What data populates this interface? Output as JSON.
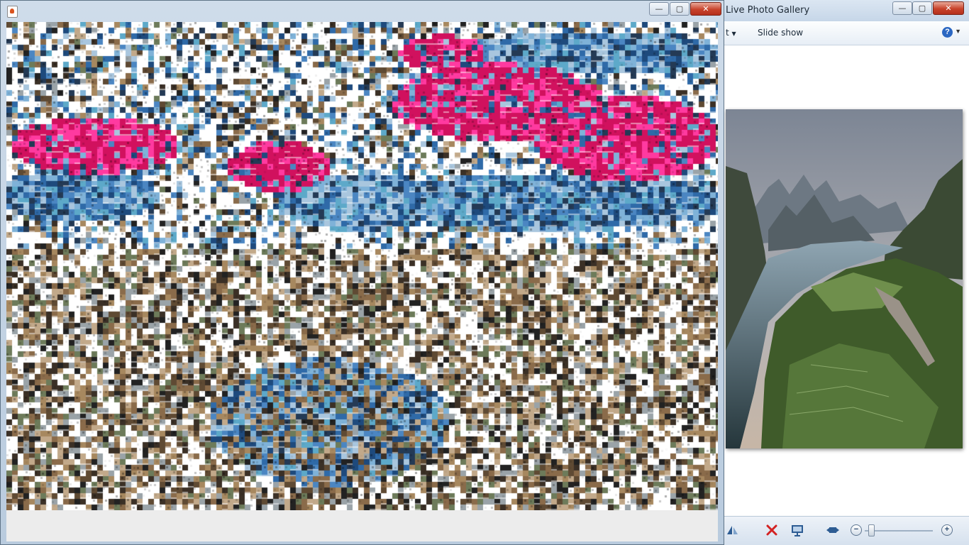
{
  "background_window": {
    "title": "Live Photo Gallery",
    "toolbar": {
      "menu_fragment": "t",
      "slideshow_label": "Slide show",
      "help_label": "?"
    },
    "statusbar": {
      "icons": [
        "fit-window-icon",
        "rotate-icon",
        "delete-icon",
        "slideshow-play-icon",
        "actual-size-icon"
      ],
      "zoom_level": 0.05
    },
    "caption_buttons": {
      "minimize": "—",
      "maximize": "▢",
      "close": "✕"
    }
  },
  "foreground_window": {
    "title": "",
    "caption_buttons": {
      "minimize": "—",
      "maximize": "▢",
      "close": "✕"
    },
    "content": "photo-mosaic"
  },
  "colors": {
    "mosaic_magenta": "#d1115e",
    "mosaic_blue": "#2f6aa8",
    "mosaic_white": "#ffffff",
    "mosaic_earth": "#8a6b4a"
  }
}
